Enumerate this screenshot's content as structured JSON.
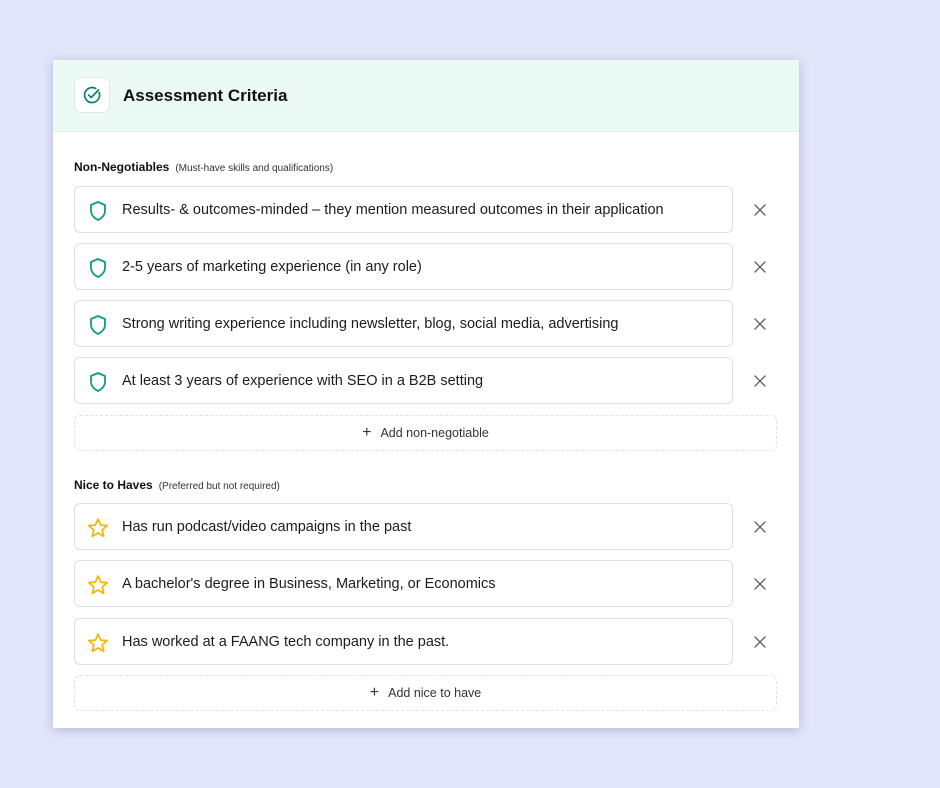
{
  "header": {
    "title": "Assessment Criteria",
    "icon": "check-circle-icon"
  },
  "non_negotiables": {
    "title": "Non-Negotiables",
    "subtitle": "(Must-have skills and qualifications)",
    "item_icon": "shield-icon",
    "item_icon_color": "#0f9d7e",
    "items": [
      "Results- & outcomes-minded – they mention measured outcomes in their application",
      "2-5 years of marketing experience (in any role)",
      "Strong writing experience including newsletter, blog, social media, advertising",
      "At least 3 years of experience with SEO in a B2B setting"
    ],
    "add_label": "Add non-negotiable"
  },
  "nice_to_haves": {
    "title": "Nice to Haves",
    "subtitle": "(Preferred but not required)",
    "item_icon": "star-icon",
    "item_icon_color": "#f2b705",
    "items": [
      "Has run podcast/video campaigns in the past",
      "A bachelor's degree in Business, Marketing, or Economics",
      "Has worked at a FAANG tech company in the past."
    ],
    "add_label": "Add nice to have"
  },
  "colors": {
    "background": "#e1e6fb",
    "header_bg": "#ecfaf6",
    "accent": "#0f9d7e",
    "star": "#f2b705"
  }
}
